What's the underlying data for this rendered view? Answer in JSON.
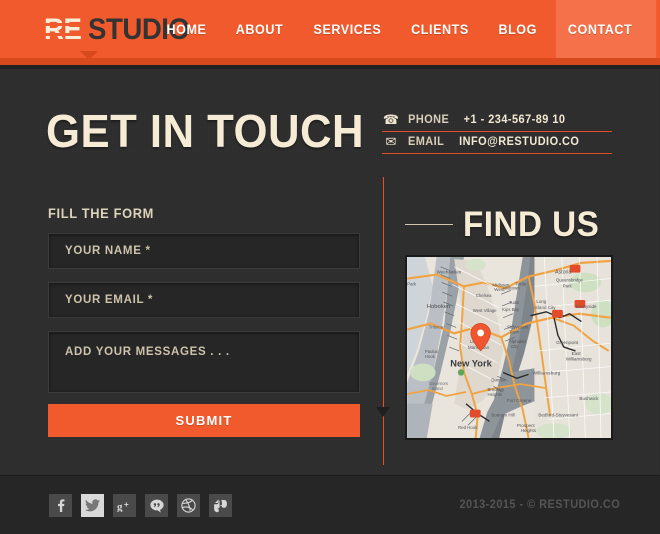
{
  "header": {
    "logo": {
      "part1": "RE",
      "part2": "STUDIO"
    },
    "nav": [
      {
        "label": "HOME",
        "active": false
      },
      {
        "label": "ABOUT",
        "active": false
      },
      {
        "label": "SERVICES",
        "active": false
      },
      {
        "label": "CLIENTS",
        "active": false
      },
      {
        "label": "BLOG",
        "active": false
      },
      {
        "label": "CONTACT",
        "active": true
      }
    ]
  },
  "main": {
    "page_title": "GET IN TOUCH",
    "contact": {
      "phone": {
        "icon": "telephone-icon",
        "glyph": "☎",
        "label": "PHONE",
        "value": "+1 - 234-567-89 10"
      },
      "email": {
        "icon": "envelope-icon",
        "glyph": "✉",
        "label": "EMAIL",
        "value": "INFO@RESTUDIO.CO"
      }
    },
    "form": {
      "heading": "FILL THE FORM",
      "name": {
        "value": "",
        "placeholder": "YOUR NAME *"
      },
      "email": {
        "value": "",
        "placeholder": "YOUR EMAIL *"
      },
      "message": {
        "value": "",
        "placeholder": "ADD YOUR MESSAGES . . ."
      },
      "submit_label": "SUBMIT"
    },
    "findus": {
      "title": "FIND US",
      "map_city_label": "New York",
      "map_labels": [
        "Astoria",
        "Queensbridge Park",
        "Midtown West",
        "Midtown",
        "Chelsea",
        "Hoboken",
        "West Village",
        "Kips Bay",
        "Alphabet City",
        "Long Island City",
        "Sunnyside",
        "Greenpoint",
        "East Williamsburg",
        "Williamsburg",
        "Lower Manhattan",
        "Dumbo",
        "Brooklyn Heights",
        "Fort Greene",
        "Bushwick",
        "Boerum Hill",
        "Bedford-Stuyvesant",
        "Prospect Heights",
        "Red Hook",
        "Tudor City",
        "Paulus Hook",
        "Weehawken",
        "Turtle Bay"
      ]
    }
  },
  "footer": {
    "social": [
      {
        "name": "facebook",
        "glyph": "f",
        "highlight": false
      },
      {
        "name": "twitter",
        "glyph": "t",
        "highlight": true
      },
      {
        "name": "google-plus",
        "glyph": "g+",
        "highlight": false
      },
      {
        "name": "comments",
        "glyph": "”",
        "highlight": false
      },
      {
        "name": "dribbble",
        "glyph": "o",
        "highlight": false
      },
      {
        "name": "evernote",
        "glyph": "e",
        "highlight": false
      }
    ],
    "copyright": "2013-2015 -  © RESTUDIO.CO"
  },
  "colors": {
    "brand_orange": "#f15a2c",
    "brand_orange_light": "#f47149",
    "brand_orange_dark": "#d84a1e",
    "cream": "#f6ebd4",
    "bg_dark": "#2d2d2d",
    "footer_bg": "#262626"
  }
}
